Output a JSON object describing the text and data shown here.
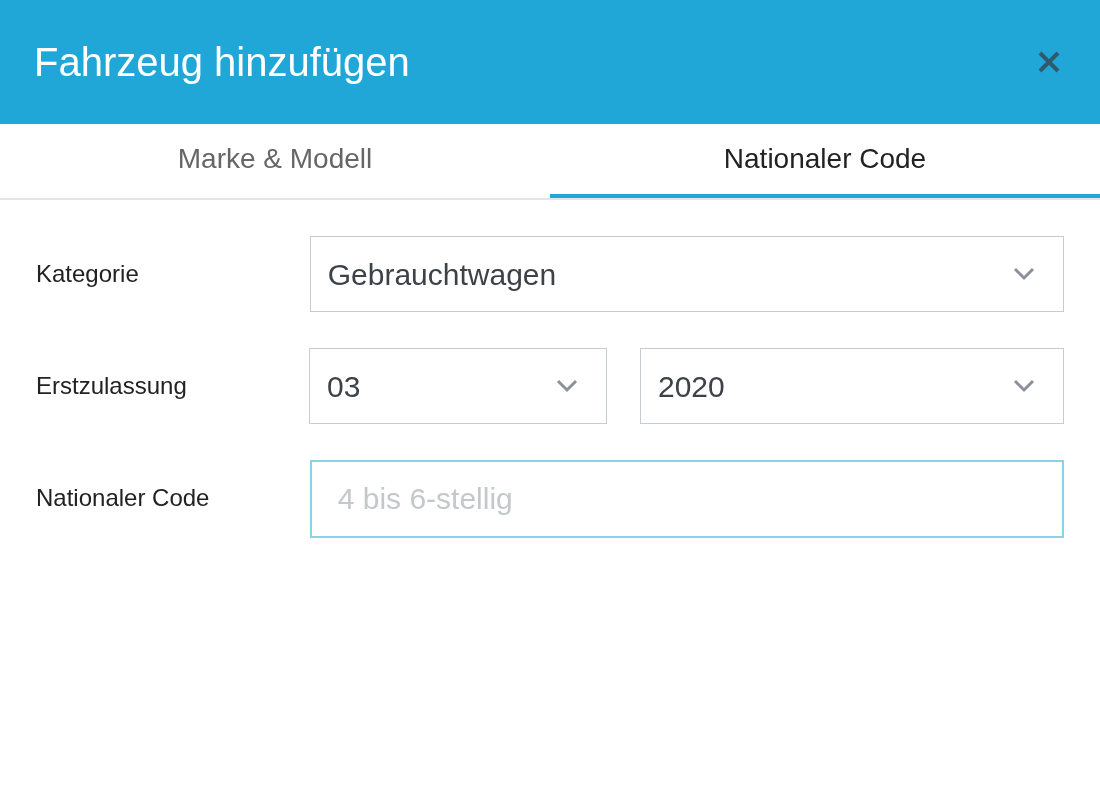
{
  "dialog": {
    "title": "Fahrzeug hinzufügen"
  },
  "tabs": [
    {
      "label": "Marke & Modell",
      "selected": false
    },
    {
      "label": "Nationaler Code",
      "selected": true
    }
  ],
  "fields": [
    {
      "kind": "select",
      "label": "Kategorie",
      "values": [
        "Gebrauchtwagen"
      ]
    },
    {
      "kind": "select",
      "label": "Erstzulassung",
      "values": [
        "03",
        "2020"
      ]
    },
    {
      "kind": "input",
      "label": "Nationaler Code",
      "placeholder": "4 bis 6-stellig",
      "focused": true
    }
  ]
}
